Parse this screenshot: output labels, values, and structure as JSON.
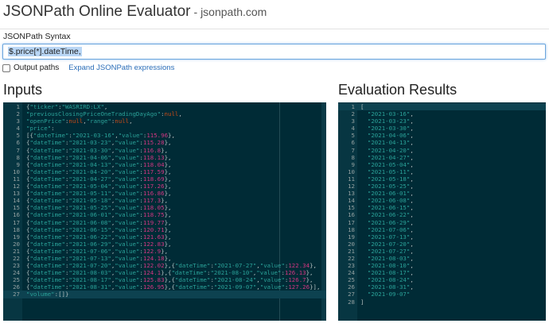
{
  "header": {
    "title": "JSONPath Online Evaluator",
    "site": "- jsonpath.com"
  },
  "syntax": {
    "label": "JSONPath Syntax",
    "query": "$.price[*].dateTime,"
  },
  "options": {
    "output_paths_label": "Output paths",
    "expand_link": "Expand JSONPath expressions"
  },
  "inputs": {
    "heading": "Inputs",
    "lines": [
      "{\"ticker\":\"WASRIRD:LX\",",
      "\"previousClosingPriceOneTradingDayAgo\":null,",
      "\"openPrice\":null,\"range\":null,",
      "\"price\":",
      "[{\"dateTime\":\"2021-03-16\",\"value\":115.96},",
      "{\"dateTime\":\"2021-03-23\",\"value\":115.28},",
      "{\"dateTime\":\"2021-03-30\",\"value\":116.8},",
      "{\"dateTime\":\"2021-04-06\",\"value\":118.13},",
      "{\"dateTime\":\"2021-04-13\",\"value\":118.04},",
      "{\"dateTime\":\"2021-04-20\",\"value\":117.59},",
      "{\"dateTime\":\"2021-04-27\",\"value\":118.69},",
      "{\"dateTime\":\"2021-05-04\",\"value\":117.26},",
      "{\"dateTime\":\"2021-05-11\",\"value\":116.86},",
      "{\"dateTime\":\"2021-05-18\",\"value\":117.3},",
      "{\"dateTime\":\"2021-05-25\",\"value\":118.05},",
      "{\"dateTime\":\"2021-06-01\",\"value\":118.75},",
      "{\"dateTime\":\"2021-06-08\",\"value\":119.77},",
      "{\"dateTime\":\"2021-06-15\",\"value\":120.71},",
      "{\"dateTime\":\"2021-06-22\",\"value\":121.63},",
      "{\"dateTime\":\"2021-06-29\",\"value\":122.83},",
      "{\"dateTime\":\"2021-07-06\",\"value\":122.9},",
      "{\"dateTime\":\"2021-07-13\",\"value\":124.18},",
      "{\"dateTime\":\"2021-07-20\",\"value\":122.02},{\"dateTime\":\"2021-07-27\",\"value\":122.34},",
      "{\"dateTime\":\"2021-08-03\",\"value\":124.1},{\"dateTime\":\"2021-08-10\",\"value\":126.13},",
      "{\"dateTime\":\"2021-08-17\",\"value\":125.83},{\"dateTime\":\"2021-08-24\",\"value\":126.7},",
      "{\"dateTime\":\"2021-08-31\",\"value\":126.95},{\"dateTime\":\"2021-09-07\",\"value\":127.26}],",
      "\"volume\":[]}"
    ]
  },
  "results": {
    "heading": "Evaluation Results",
    "lines": [
      "[",
      "  \"2021-03-16\",",
      "  \"2021-03-23\",",
      "  \"2021-03-30\",",
      "  \"2021-04-06\",",
      "  \"2021-04-13\",",
      "  \"2021-04-20\",",
      "  \"2021-04-27\",",
      "  \"2021-05-04\",",
      "  \"2021-05-11\",",
      "  \"2021-05-18\",",
      "  \"2021-05-25\",",
      "  \"2021-06-01\",",
      "  \"2021-06-08\",",
      "  \"2021-06-15\",",
      "  \"2021-06-22\",",
      "  \"2021-06-29\",",
      "  \"2021-07-06\",",
      "  \"2021-07-13\",",
      "  \"2021-07-20\",",
      "  \"2021-07-27\",",
      "  \"2021-08-03\",",
      "  \"2021-08-10\",",
      "  \"2021-08-17\",",
      "  \"2021-08-24\",",
      "  \"2021-08-31\",",
      "  \"2021-09-07\"",
      "]"
    ]
  },
  "colors": {
    "editor_bg": "#002b36",
    "gutter_bg": "#073642",
    "key": "#2aa198",
    "string": "#2aa198",
    "number": "#d33682",
    "punct": "#b3c0c0"
  }
}
